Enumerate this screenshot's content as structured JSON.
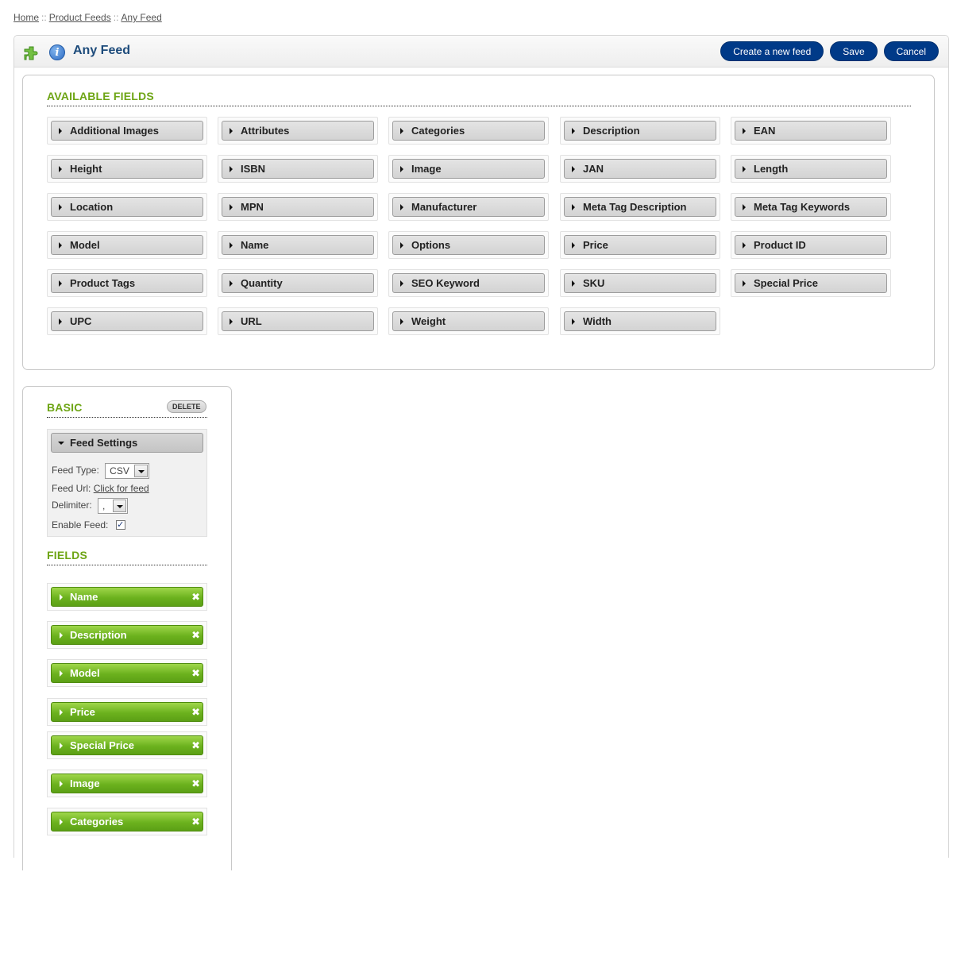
{
  "breadcrumb": {
    "items": [
      "Home",
      "Product Feeds",
      "Any Feed"
    ],
    "separator": "::"
  },
  "header": {
    "title": "Any Feed",
    "buttons": {
      "create": "Create a new feed",
      "save": "Save",
      "cancel": "Cancel"
    }
  },
  "available": {
    "title": "AVAILABLE FIELDS",
    "fields": [
      "Additional Images",
      "Attributes",
      "Categories",
      "Description",
      "EAN",
      "Height",
      "ISBN",
      "Image",
      "JAN",
      "Length",
      "Location",
      "MPN",
      "Manufacturer",
      "Meta Tag Description",
      "Meta Tag Keywords",
      "Model",
      "Name",
      "Options",
      "Price",
      "Product ID",
      "Product Tags",
      "Quantity",
      "SEO Keyword",
      "SKU",
      "Special Price",
      "UPC",
      "URL",
      "Weight",
      "Width"
    ]
  },
  "basic": {
    "title": "BASIC",
    "delete_label": "DELETE",
    "settings": {
      "title": "Feed Settings",
      "feed_type_label": "Feed Type:",
      "feed_type_value": "CSV",
      "feed_url_label": "Feed Url:",
      "feed_url_link": "Click for feed",
      "delimiter_label": "Delimiter:",
      "delimiter_value": ",",
      "enable_label": "Enable Feed:",
      "enable_checked": true
    },
    "fields_title": "FIELDS",
    "selected_fields": [
      "Name",
      "Description",
      "Model",
      "Price",
      "Special Price",
      "Image",
      "Categories"
    ]
  },
  "icons": {
    "plugin": "puzzle-icon",
    "info": "info-icon",
    "expand": "triangle-right-icon",
    "remove": "close-icon"
  },
  "colors": {
    "accent_green": "#6ea515",
    "button_blue": "#003a88",
    "title_blue": "#1d4b7b"
  }
}
